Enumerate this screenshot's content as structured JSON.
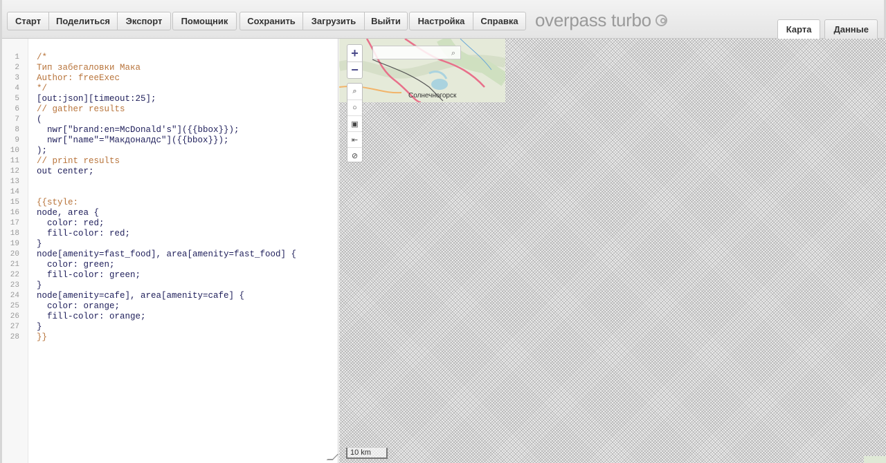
{
  "toolbar": {
    "group1": [
      "Старт",
      "Поделиться",
      "Экспорт"
    ],
    "group2": [
      "Помощник"
    ],
    "group3": [
      "Сохранить",
      "Загрузить",
      "Выйти"
    ],
    "group4": [
      "Настройка",
      "Справка"
    ],
    "brand": "overpass turbo",
    "tabs": {
      "map": "Карта",
      "data": "Данные"
    }
  },
  "editor": {
    "lines": [
      {
        "n": "1",
        "t": "/*"
      },
      {
        "n": "2",
        "t": "Тип забегаловки Мака"
      },
      {
        "n": "3",
        "t": "Author: freeExec"
      },
      {
        "n": "4",
        "t": "*/"
      },
      {
        "n": "5",
        "t": "[out:json][timeout:25];"
      },
      {
        "n": "6",
        "t": "// gather results"
      },
      {
        "n": "7",
        "t": "("
      },
      {
        "n": "8",
        "t": "  nwr[\"brand:en=McDonald's\"]({{bbox}});"
      },
      {
        "n": "9",
        "t": "  nwr[\"name\"=\"Макдоналдс\"]({{bbox}});"
      },
      {
        "n": "10",
        "t": ");"
      },
      {
        "n": "11",
        "t": "// print results"
      },
      {
        "n": "12",
        "t": "out center;"
      },
      {
        "n": "13",
        "t": ""
      },
      {
        "n": "14",
        "t": ""
      },
      {
        "n": "15",
        "t": "{{style:"
      },
      {
        "n": "16",
        "t": "node, area {"
      },
      {
        "n": "17",
        "t": "  color: red;"
      },
      {
        "n": "18",
        "t": "  fill-color: red;"
      },
      {
        "n": "19",
        "t": "}"
      },
      {
        "n": "20",
        "t": "node[amenity=fast_food], area[amenity=fast_food] {"
      },
      {
        "n": "21",
        "t": "  color: green;"
      },
      {
        "n": "22",
        "t": "  fill-color: green;"
      },
      {
        "n": "23",
        "t": "}"
      },
      {
        "n": "24",
        "t": "node[amenity=cafe], area[amenity=cafe] {"
      },
      {
        "n": "25",
        "t": "  color: orange;"
      },
      {
        "n": "26",
        "t": "  fill-color: orange;"
      },
      {
        "n": "27",
        "t": "}"
      },
      {
        "n": "28",
        "t": "}}"
      }
    ]
  },
  "map": {
    "place_label": "Солнечногорск",
    "search_placeholder": "",
    "zoom_in": "+",
    "zoom_out": "−",
    "scale": "10 km"
  }
}
